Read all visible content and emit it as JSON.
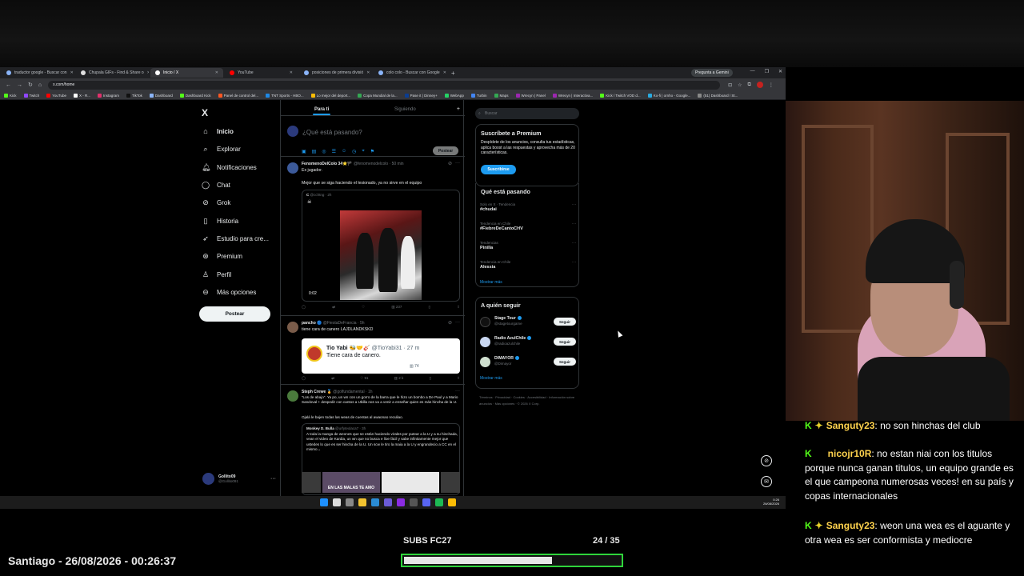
{
  "browser": {
    "tabs": [
      {
        "label": "traductor google - Buscar con",
        "active": false
      },
      {
        "label": "Chupala GIFs - Find & Share o",
        "active": false
      },
      {
        "label": "Inicio / X",
        "active": true
      },
      {
        "label": "YouTube",
        "active": false
      },
      {
        "label": "posiciones de primera divisió",
        "active": false
      },
      {
        "label": "colo colo - Buscar con Google",
        "active": false
      }
    ],
    "gemini_label": "Pregunta a Gemini",
    "url": "x.com/home",
    "bookmarks": [
      "Kick",
      "Twitch",
      "YouTube",
      "X - R...",
      "Instagram",
      "TikTok",
      "Dashboard",
      "Dashboard Kick",
      "Panel de control del...",
      "TNT Sports - HBO...",
      "Lo mejor del deport...",
      "Copa Mundial de la...",
      "Pase it | Dinney+",
      "WebApp",
      "Turbin",
      "Maps",
      "Wrecyn | Panel",
      "Wrecyn | Interactiva...",
      "Kick / Twitch VOD d...",
      "Ko-fi | ornho - Google...",
      "(51) Dashboard / St..."
    ]
  },
  "x_nav": {
    "logo": "X",
    "items": [
      {
        "label": "Inicio",
        "icon": "home-icon"
      },
      {
        "label": "Explorar",
        "icon": "search-icon"
      },
      {
        "label": "Notificaciones",
        "icon": "bell-icon"
      },
      {
        "label": "Chat",
        "icon": "chat-icon"
      },
      {
        "label": "Grok",
        "icon": "grok-icon"
      },
      {
        "label": "Historia",
        "icon": "bookmark-icon"
      },
      {
        "label": "Estudio para cre...",
        "icon": "rocket-icon"
      },
      {
        "label": "Premium",
        "icon": "premium-icon"
      },
      {
        "label": "Perfil",
        "icon": "profile-icon"
      },
      {
        "label": "Más opciones",
        "icon": "more-icon"
      }
    ],
    "post_label": "Postear",
    "account": {
      "name": "Gollito09",
      "handle": "@Gollito091"
    }
  },
  "feed": {
    "tab_for_you": "Para ti",
    "tab_following": "Siguiendo",
    "composer_placeholder": "¿Qué está pasando?",
    "composer_post": "Postear",
    "tweets": [
      {
        "name": "FenomenoDelColo 34⭐🏴",
        "handle": "@fenomenodelcolo · 50 min",
        "text1": "Ex jugador.",
        "text2": "Mejor que se siga haciendo el lesionado, ya no sirve en el equipo",
        "quote_name": "C",
        "quote_handle": "@cchtng · 2h",
        "video_time": "0:02",
        "views": "237"
      },
      {
        "name": "pancho 🔵",
        "handle": "@FiestaDeFrancia · 5h",
        "text": "tiene cara de canero LAJDLANDKSKD",
        "quote_name": "Tio Yabi",
        "quote_handle": "@TioYabi31 · 27 m",
        "quote_text": "Tiene cara de canero.",
        "quote_views": "74",
        "likes": "91",
        "views": "2 k"
      },
      {
        "name": "Steph Crewe 🏅",
        "handle": "@golfundamental · 1h",
        "text1": "“Los de abajo”. Ya po, un wn con un gorro de la barra que le hizo un bombo a De Paul y a Mario Sandoval + despedir con cantos a Ubilla nos va a venir a enseñar quien es más hincha de la U.",
        "text2": "Ojalá le bajen todas las weas de cuentas al awaonao reculiao.",
        "quote_name": "Monkey D. Bulla",
        "quote_handle": "@urfyteolaca7 · 3h",
        "quote_text": "A toda la manga de weones que se están haciendo virales por putear a la U y a su hinchada, vean el video de Kardia, un wn que no busca e lloe fácil y sabe infinitamente mejor que ustedes lo que es ser hincha de la U. Un scw le tiro la maia a la U y engrandecio a CC en el mismo→",
        "thumb_caption": "EN LAS MALAS TE AMO"
      }
    ]
  },
  "sidebar": {
    "search_placeholder": "Buscar",
    "premium": {
      "title": "Suscríbete a Premium",
      "desc": "Despídete de los anuncios, consulta tus estadísticas, aplica boost a las respuestas y aprovecha más de 20 características.",
      "button": "Suscribirse"
    },
    "trends_title": "Qué está pasando",
    "trends": [
      {
        "context": "Solo en X · Tendencia",
        "name": "#chudai"
      },
      {
        "context": "Tendencia en Chile",
        "name": "#FiebreDeCantoCHV"
      },
      {
        "context": "Tendencias",
        "name": "Pinilla"
      },
      {
        "context": "Tendencia en Chile",
        "name": "Alessia"
      }
    ],
    "show_more": "Mostrar más",
    "follow_title": "A quién seguir",
    "follow": [
      {
        "name": "Stage Tour",
        "handle": "@stagetourgame",
        "button": "Seguir"
      },
      {
        "name": "Radio AzulChile",
        "handle": "@radioazulchile",
        "button": "Seguir"
      },
      {
        "name": "DIMAYOR",
        "handle": "@Dimayor",
        "button": "Seguir"
      }
    ],
    "follow_more": "Mostrar más",
    "footer": "Términos · Privacidad · Cookies · Accesibilidad · Información sobre anuncios · Más opciones · © 2026 X Corp."
  },
  "taskbar": {
    "time": "0:26",
    "date": "26/08/2026"
  },
  "chat": [
    {
      "user": "Sanguty23",
      "text": ": no son hinchas del club"
    },
    {
      "user": "nicojr10R",
      "text": ": no estan niai con los titulos porque nunca ganan titulos, un equipo grande es el que campeona numerosas veces! en su país y copas internacionales"
    },
    {
      "user": "Sanguty23",
      "text": ": weon una wea es el aguante y otra wea es ser conformista y mediocre"
    }
  ],
  "overlay": {
    "datetime": "Santiago - 26/08/2026 - 00:26:37",
    "subs_label": "SUBS FC27",
    "subs_count": "24 / 35",
    "subs_progress": 0.6857
  },
  "colors": {
    "accent": "#1d9bf0",
    "kick_green": "#53fc18",
    "progress_border": "#2fd43b"
  }
}
